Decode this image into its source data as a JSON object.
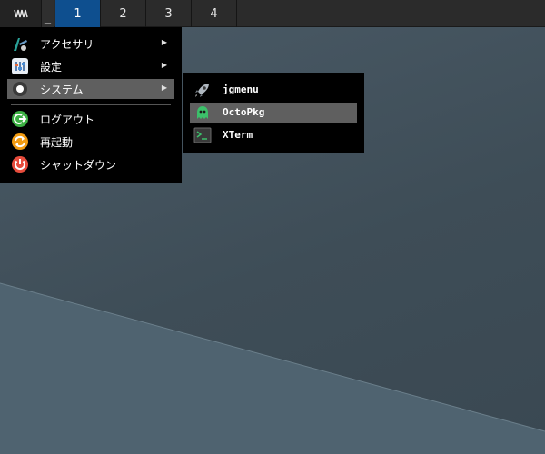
{
  "panel": {
    "show_desktop_label": "_",
    "workspaces": [
      {
        "label": "1",
        "active": true
      },
      {
        "label": "2",
        "active": false
      },
      {
        "label": "3",
        "active": false
      },
      {
        "label": "4",
        "active": false
      }
    ],
    "accent_color": "#0e4f8f"
  },
  "main_menu": {
    "items": [
      {
        "label": "アクセサリ",
        "icon": "accessories-icon",
        "has_submenu": true
      },
      {
        "label": "設定",
        "icon": "settings-icon",
        "has_submenu": true
      },
      {
        "label": "システム",
        "icon": "system-icon",
        "has_submenu": true,
        "selected": true
      },
      {
        "label": "ログアウト",
        "icon": "logout-icon",
        "has_submenu": false
      },
      {
        "label": "再起動",
        "icon": "reboot-icon",
        "has_submenu": false
      },
      {
        "label": "シャットダウン",
        "icon": "shutdown-icon",
        "has_submenu": false
      }
    ]
  },
  "system_submenu": {
    "items": [
      {
        "label": "jgmenu",
        "icon": "rocket-icon"
      },
      {
        "label": "OctoPkg",
        "icon": "octopkg-icon",
        "selected": true
      },
      {
        "label": "XTerm",
        "icon": "terminal-icon"
      }
    ]
  }
}
